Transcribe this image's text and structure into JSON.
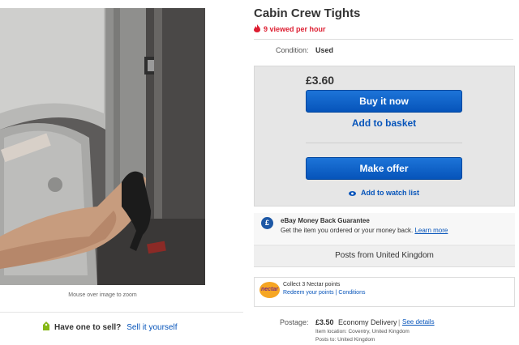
{
  "listing": {
    "title": "Cabin Crew Tights",
    "viewed": "9 viewed per hour",
    "condition_label": "Condition:",
    "condition_value": "Used"
  },
  "gallery": {
    "zoom_hint": "Mouse over image to zoom"
  },
  "buy_box": {
    "price": "£3.60",
    "buy_now_label": "Buy it now",
    "add_to_basket_label": "Add to basket",
    "make_offer_label": "Make offer",
    "watch_label": "Add to watch list"
  },
  "guarantee": {
    "icon_glyph": "£",
    "title": "eBay Money Back Guarantee",
    "text": "Get the item you ordered or your money back.",
    "learn_more": "Learn more"
  },
  "posts_from": "Posts from United Kingdom",
  "nectar": {
    "logo_text": "nectar",
    "line1": "Collect 3 Nectar points",
    "redeem": "Redeem your points",
    "separator": "|",
    "conditions": "Conditions"
  },
  "postage": {
    "label": "Postage:",
    "price": "£3.50",
    "method": "Economy Delivery",
    "separator": "|",
    "details_link": "See details",
    "item_location": "Item location:  Coventry, United Kingdom",
    "posts_to": "Posts to:  United Kingdom"
  },
  "sell": {
    "question": "Have one to sell?",
    "link": "Sell it yourself"
  },
  "colors": {
    "link_blue": "#0654ba",
    "button_blue": "#1d74d8",
    "alert_red": "#dd1e31",
    "nectar_orange": "#f6a623"
  }
}
